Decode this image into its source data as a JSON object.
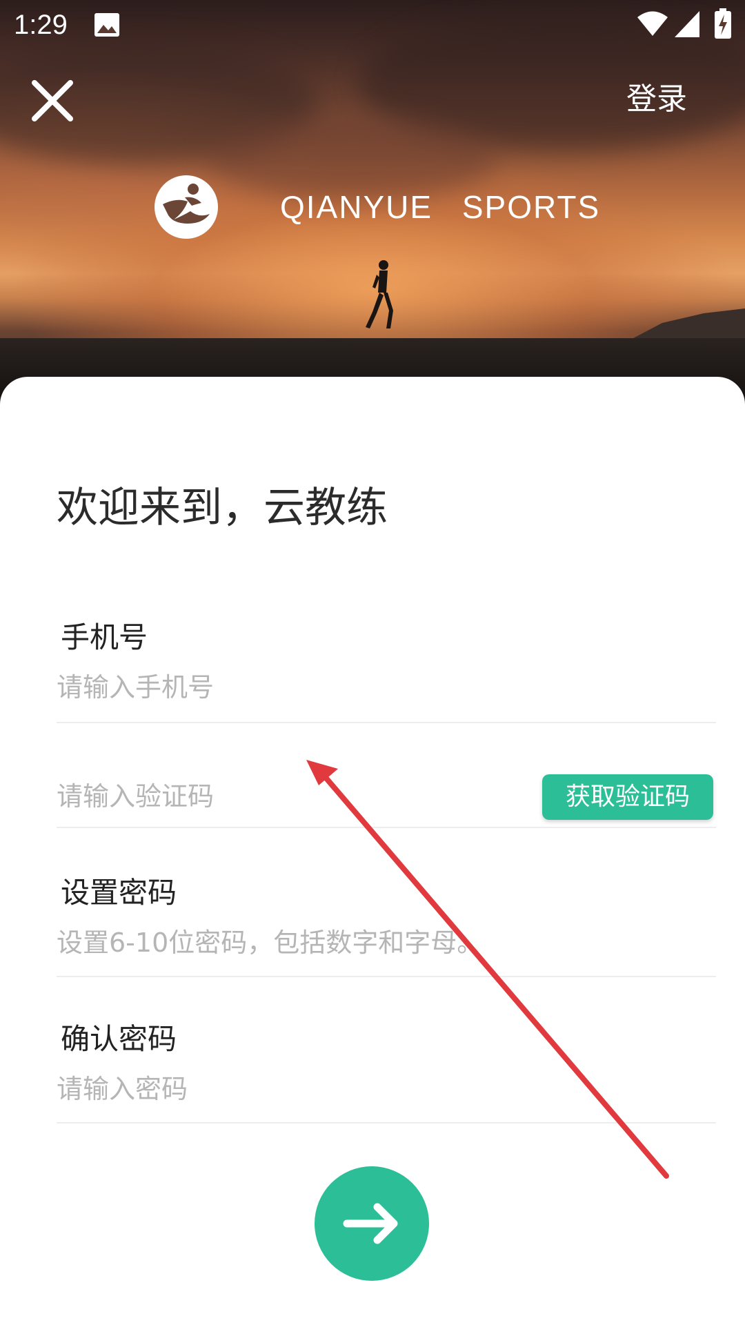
{
  "status_bar": {
    "time": "1:29",
    "icons": [
      "image-icon",
      "wifi-icon",
      "signal-icon",
      "battery-charging-icon"
    ]
  },
  "header": {
    "close_icon": "close-icon",
    "login_label": "登录",
    "brand_logo": "runner-logo-icon",
    "brand_name": "QIANYUE SPORTS"
  },
  "form": {
    "welcome": "欢迎来到，云教练",
    "phone": {
      "label": "手机号",
      "placeholder": "请输入手机号",
      "value": ""
    },
    "code": {
      "placeholder": "请输入验证码",
      "value": "",
      "button_label": "获取验证码"
    },
    "password": {
      "label": "设置密码",
      "placeholder": "设置6-10位密码，包括数字和字母。",
      "value": ""
    },
    "confirm": {
      "label": "确认密码",
      "placeholder": "请输入密码",
      "value": ""
    },
    "submit_icon": "arrow-right-icon"
  },
  "colors": {
    "accent": "#2cbf97",
    "annotation": "#e0393e",
    "placeholder": "#b5b5b5"
  }
}
